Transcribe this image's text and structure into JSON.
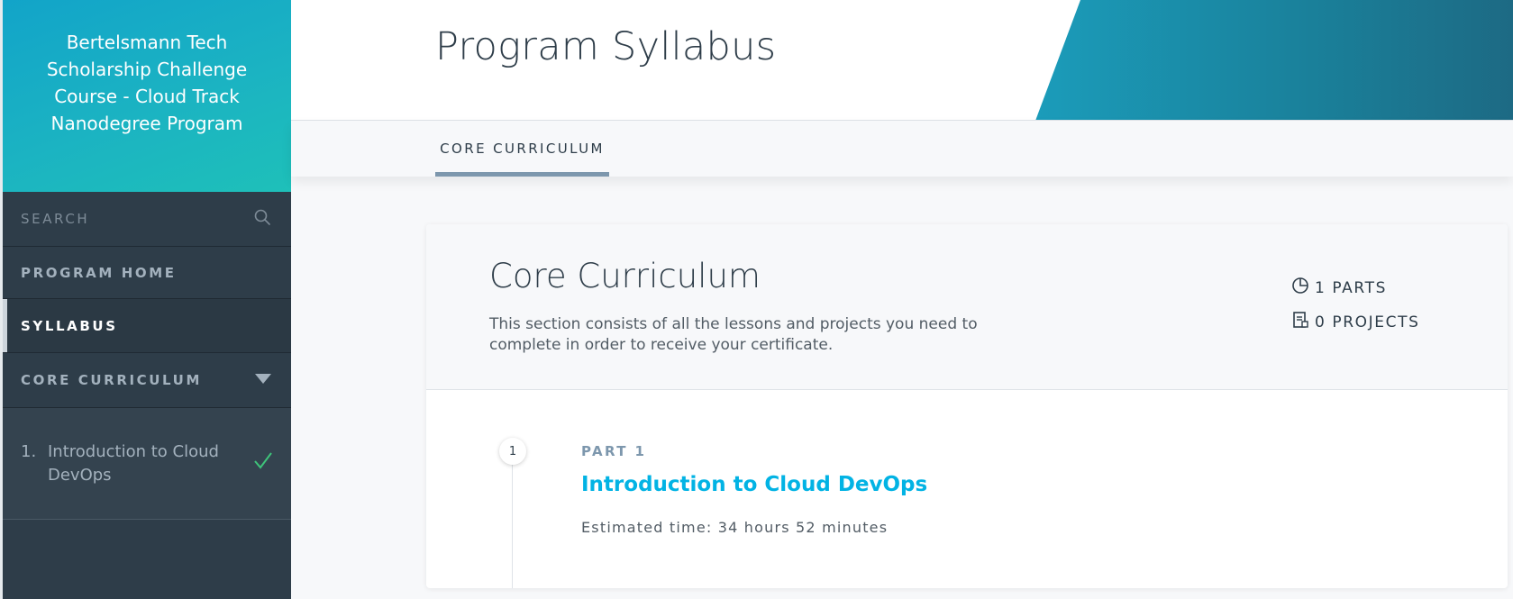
{
  "sidebar": {
    "program_title": "Bertelsmann Tech Scholarship Challenge Course - Cloud Track Nanodegree Program",
    "search_label": "SEARCH",
    "search_icon": "search-icon",
    "nav_home": "PROGRAM HOME",
    "nav_syllabus": "SYLLABUS",
    "nav_core": "CORE CURRICULUM",
    "lessons": [
      {
        "number": "1.",
        "title": "Introduction to Cloud DevOps",
        "completed": true
      }
    ]
  },
  "header": {
    "title": "Program Syllabus"
  },
  "tabs": [
    {
      "label": "CORE CURRICULUM",
      "active": true
    }
  ],
  "section": {
    "title": "Core Curriculum",
    "description": "This section consists of all the lessons and projects you need to complete in order to receive your certificate.",
    "parts_count": "1 PARTS",
    "projects_count": "0 PROJECTS",
    "parts": [
      {
        "step": "1",
        "label": "PART 1",
        "title": "Introduction to Cloud DevOps",
        "estimated_time": "Estimated time: 34 hours 52 minutes"
      }
    ]
  },
  "colors": {
    "sidebar_bg": "#2e3d49",
    "accent_teal": "#1bb3c2",
    "link_blue": "#02b3e4",
    "check_green": "#3ec47a",
    "tab_underline": "#7d97ad"
  }
}
